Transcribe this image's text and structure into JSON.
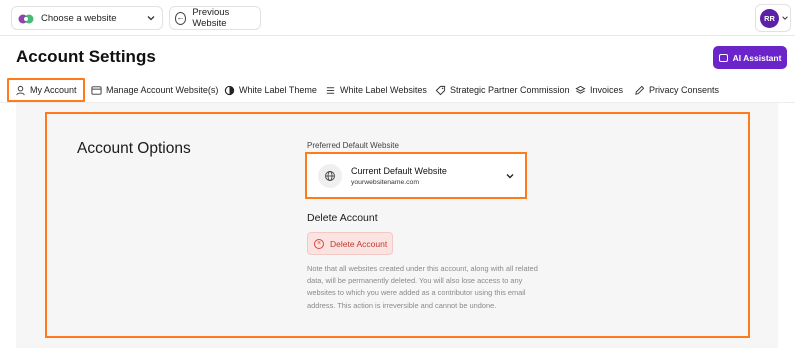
{
  "topbar": {
    "website_select_label": "Choose a website",
    "prev_button_label": "Previous Website",
    "avatar_initials": "RR"
  },
  "page": {
    "title": "Account Settings",
    "ai_button_label": "AI Assistant"
  },
  "tabs": [
    {
      "label": "My Account",
      "icon": "user-icon",
      "active": true
    },
    {
      "label": "Manage Account Website(s)",
      "icon": "browser-icon",
      "active": false
    },
    {
      "label": "White Label Theme",
      "icon": "half-circle-icon",
      "active": false
    },
    {
      "label": "White Label Websites",
      "icon": "list-icon",
      "active": false
    },
    {
      "label": "Strategic Partner Commission",
      "icon": "tag-icon",
      "active": false
    },
    {
      "label": "Invoices",
      "icon": "layers-icon",
      "active": false
    },
    {
      "label": "Privacy Consents",
      "icon": "pen-icon",
      "active": false
    }
  ],
  "account_options": {
    "title": "Account Options",
    "preferred_label": "Preferred Default Website",
    "preferred_name": "Current Default Website",
    "preferred_url": "yourwebsitename.com",
    "delete_heading": "Delete Account",
    "delete_button_label": "Delete Account",
    "delete_note": "Note that all websites created under this account, along with all related data, will be permanently deleted. You will also lose access to any websites to which you were added as a contributor using this email address. This action is irreversible and cannot be undone."
  },
  "colors": {
    "accent_orange": "#ff7a1a",
    "brand_purple": "#6a24c9",
    "danger_red": "#c0392b"
  }
}
